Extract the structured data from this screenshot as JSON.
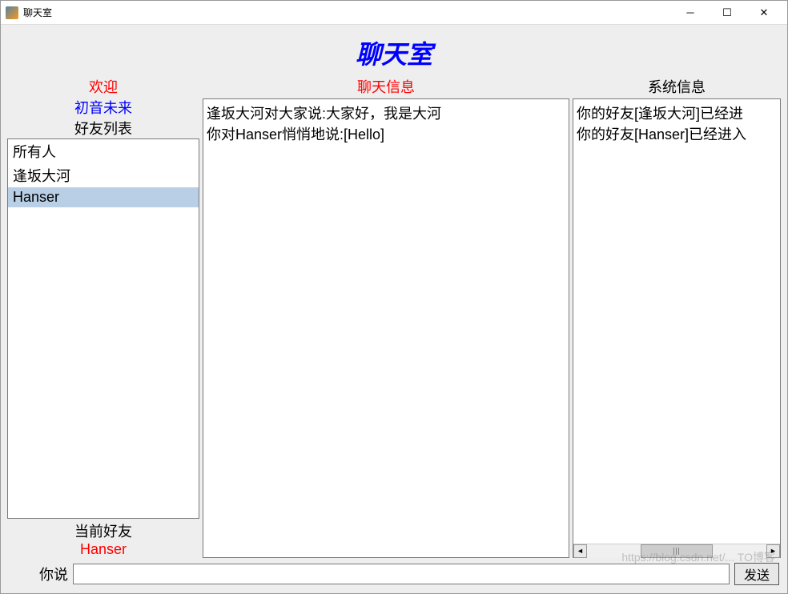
{
  "window": {
    "title": "聊天室"
  },
  "header": {
    "main_title": "聊天室"
  },
  "left": {
    "welcome_label": "欢迎",
    "current_user": "初音未来",
    "friend_list_label": "好友列表",
    "friends": [
      "所有人",
      "逢坂大河",
      "Hanser"
    ],
    "selected_friend_index": 2,
    "current_friend_label": "当前好友",
    "current_friend": "Hanser"
  },
  "mid": {
    "header": "聊天信息",
    "messages": [
      "逢坂大河对大家说:大家好，我是大河",
      "你对Hanser悄悄地说:[Hello]"
    ]
  },
  "right": {
    "header": "系统信息",
    "messages": [
      "你的好友[逢坂大河]已经进",
      "你的好友[Hanser]已经进入"
    ]
  },
  "input": {
    "label": "你说",
    "value": "",
    "send_label": "发送"
  },
  "watermark": "https://blog.csdn.net/... TO博客"
}
